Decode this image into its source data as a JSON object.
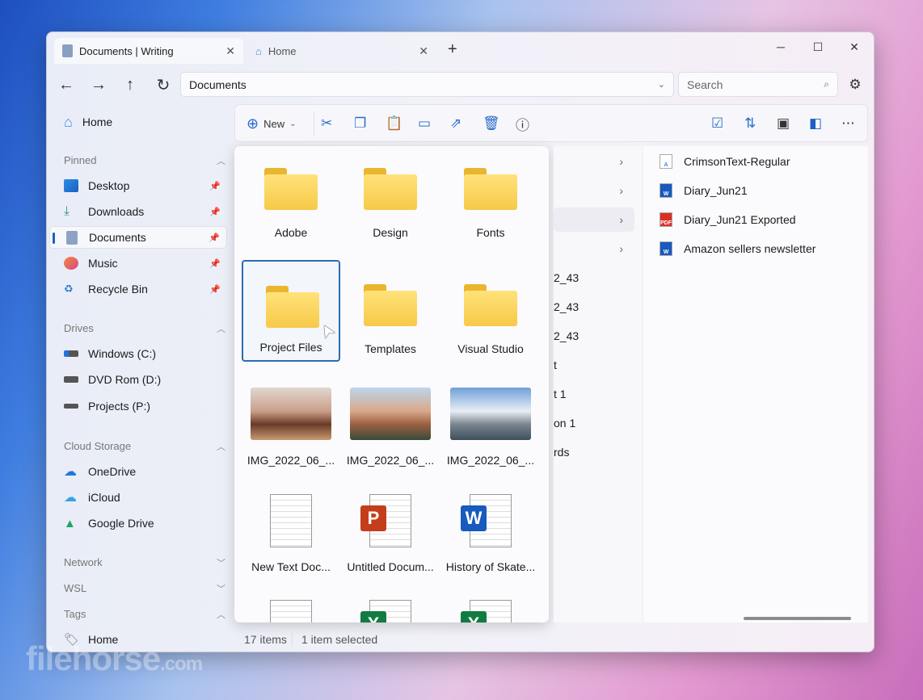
{
  "tabs": [
    {
      "label": "Documents | Writing",
      "active": true
    },
    {
      "label": "Home",
      "active": false
    }
  ],
  "nav": {
    "address": "Documents",
    "search_placeholder": "Search"
  },
  "sidebar": {
    "home": "Home",
    "pinned_header": "Pinned",
    "pinned": [
      {
        "label": "Desktop",
        "icon": "desktop-icon"
      },
      {
        "label": "Downloads",
        "icon": "download-icon"
      },
      {
        "label": "Documents",
        "icon": "documents-icon",
        "selected": true
      },
      {
        "label": "Music",
        "icon": "music-icon"
      },
      {
        "label": "Recycle Bin",
        "icon": "recycle-bin-icon"
      }
    ],
    "drives_header": "Drives",
    "drives": [
      {
        "label": "Windows (C:)"
      },
      {
        "label": "DVD Rom (D:)"
      },
      {
        "label": "Projects (P:)"
      }
    ],
    "cloud_header": "Cloud Storage",
    "cloud": [
      {
        "label": "OneDrive"
      },
      {
        "label": "iCloud"
      },
      {
        "label": "Google Drive"
      }
    ],
    "network_header": "Network",
    "wsl_header": "WSL",
    "tags_header": "Tags",
    "tags": [
      {
        "label": "Home"
      }
    ]
  },
  "toolbar": {
    "new_label": "New"
  },
  "grid": {
    "items": [
      {
        "label": "Adobe",
        "type": "folder"
      },
      {
        "label": "Design",
        "type": "folder"
      },
      {
        "label": "Fonts",
        "type": "folder"
      },
      {
        "label": "Project Files",
        "type": "folder",
        "selected": true
      },
      {
        "label": "Templates",
        "type": "folder"
      },
      {
        "label": "Visual Studio",
        "type": "folder"
      },
      {
        "label": "IMG_2022_06_...",
        "type": "image"
      },
      {
        "label": "IMG_2022_06_...",
        "type": "image"
      },
      {
        "label": "IMG_2022_06_...",
        "type": "image"
      },
      {
        "label": "New Text Doc...",
        "type": "text"
      },
      {
        "label": "Untitled Docum...",
        "type": "powerpoint"
      },
      {
        "label": "History of Skate...",
        "type": "word"
      },
      {
        "label": "",
        "type": "text"
      },
      {
        "label": "",
        "type": "excel"
      },
      {
        "label": "",
        "type": "excel"
      }
    ]
  },
  "middle_column": [
    "",
    "",
    "",
    "",
    "2_43",
    "2_43",
    "2_43",
    "t",
    "t 1",
    "on 1",
    "rds"
  ],
  "right_column": [
    {
      "label": "CrimsonText-Regular",
      "type": "font"
    },
    {
      "label": "Diary_Jun21",
      "type": "word"
    },
    {
      "label": "Diary_Jun21 Exported",
      "type": "pdf"
    },
    {
      "label": "Amazon sellers newsletter",
      "type": "word"
    }
  ],
  "status": {
    "items": "17 items",
    "selected": "1 item selected"
  },
  "watermark": "filehorse.com",
  "colors": {
    "accent": "#1d5fc4",
    "selection_border": "#2d6ab4"
  }
}
